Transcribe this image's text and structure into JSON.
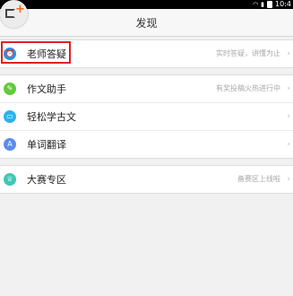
{
  "status_bar": {
    "time": "10:4",
    "icons": [
      "usb-icon",
      "check-icon",
      "wifi-icon",
      "signal-icon",
      "battery-icon"
    ]
  },
  "header": {
    "title": "发现"
  },
  "groups": [
    {
      "items": [
        {
          "label": "老师答疑",
          "desc": "实时答疑，讲懂为止",
          "icon": "alarm-clock-icon",
          "color": "#2b8fe8",
          "highlighted": true
        }
      ]
    },
    {
      "items": [
        {
          "label": "作文助手",
          "desc": "有奖投稿火热进行中",
          "icon": "document-icon",
          "color": "#63c93f"
        },
        {
          "label": "轻松学古文",
          "desc": "",
          "icon": "book-icon",
          "color": "#27b5ea"
        },
        {
          "label": "单词翻译",
          "desc": "",
          "icon": "translate-icon",
          "color": "#5b8cf0"
        }
      ]
    },
    {
      "items": [
        {
          "label": "大赛专区",
          "desc": "备赛区上线啦",
          "icon": "trophy-icon",
          "color": "#3fc7b5"
        }
      ]
    }
  ],
  "colors": {
    "highlight_border": "#e02020",
    "accent_orange": "#f06a1d"
  }
}
